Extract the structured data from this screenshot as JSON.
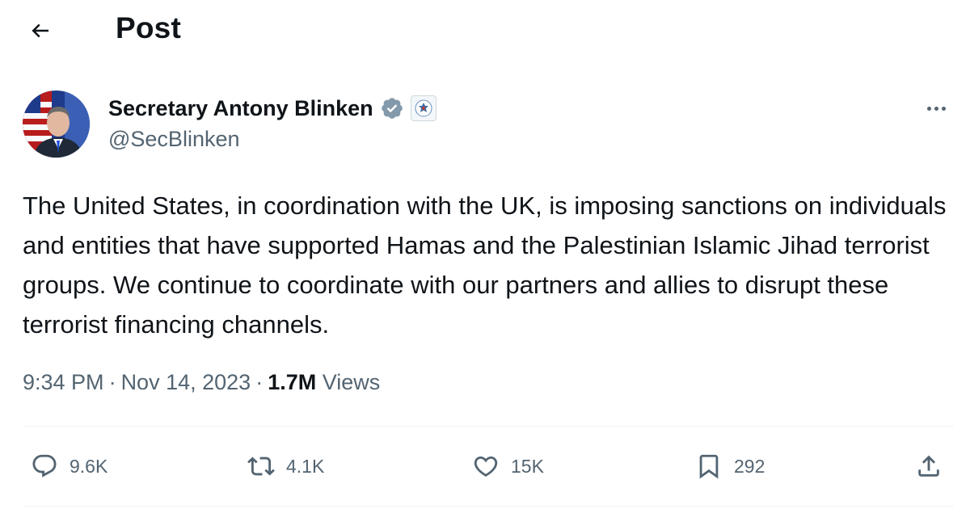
{
  "header": {
    "title": "Post",
    "back_icon": "arrow-left-icon"
  },
  "author": {
    "display_name": "Secretary Antony Blinken",
    "handle": "@SecBlinken",
    "verified_badge": "verified-badge-icon",
    "affiliation_badge": "us-state-department-seal-icon",
    "verified_color": "#829aab"
  },
  "post": {
    "text": "The United States, in coordination with the UK, is imposing sanctions on individuals and entities that have supported Hamas and the Palestinian Islamic Jihad terrorist groups. We continue to coordinate with our partners and allies to disrupt these terrorist financing channels.",
    "time": "9:34 PM",
    "separator": "·",
    "date": "Nov 14, 2023",
    "views_count": "1.7M",
    "views_label": "Views"
  },
  "actions": {
    "replies": "9.6K",
    "reposts": "4.1K",
    "likes": "15K",
    "bookmarks": "292"
  },
  "colors": {
    "text_primary": "#0f1419",
    "text_secondary": "#536471",
    "divider": "#eff3f4"
  }
}
